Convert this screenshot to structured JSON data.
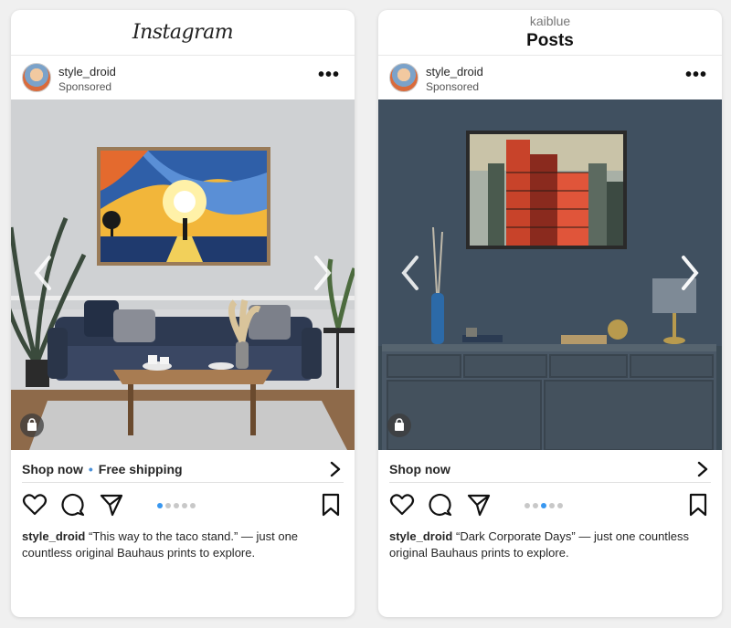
{
  "posts": [
    {
      "top_bar": {
        "logo": "Instagram",
        "account": "",
        "title": ""
      },
      "header": {
        "username": "style_droid",
        "sponsored": "Sponsored",
        "more": "•••"
      },
      "image": {
        "subject": "Bauhaus sunset print in living room"
      },
      "shop": {
        "label": "Shop now",
        "extra": "Free shipping"
      },
      "pagination": {
        "count": 5,
        "active": 0
      },
      "caption": {
        "username": "style_droid",
        "text": "“This way to the taco stand.” — just one countless original Bauhaus prints to explore."
      }
    },
    {
      "top_bar": {
        "logo": "",
        "account": "kaiblue",
        "title": "Posts"
      },
      "header": {
        "username": "style_droid",
        "sponsored": "Sponsored",
        "more": "•••"
      },
      "image": {
        "subject": "Dark Corporate Days print over sideboard"
      },
      "shop": {
        "label": "Shop now",
        "extra": ""
      },
      "pagination": {
        "count": 5,
        "active": 2
      },
      "caption": {
        "username": "style_droid",
        "text": "“Dark Corporate Days” — just one countless original Bauhaus prints to explore."
      }
    }
  ],
  "icons": {
    "heart": "heart-icon",
    "comment": "comment-icon",
    "share": "share-icon",
    "bookmark": "bookmark-icon",
    "bag": "shopping-bag-icon",
    "left": "chevron-left-icon",
    "right": "chevron-right-icon"
  },
  "colors": {
    "accent": "#3897f0",
    "text": "#262626"
  }
}
